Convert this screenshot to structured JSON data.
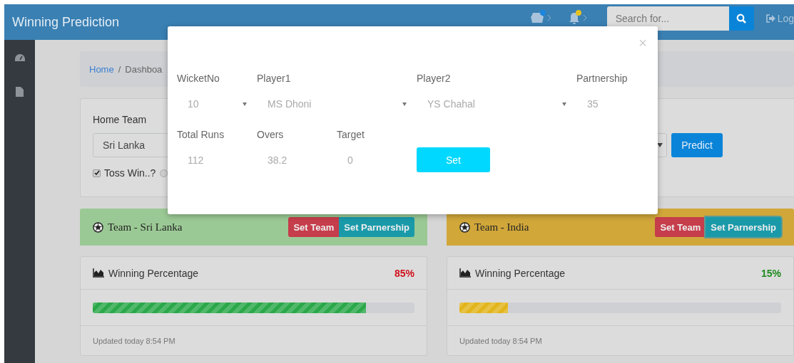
{
  "navbar": {
    "brand": "Winning Prediction",
    "notifications": [
      {
        "kind": "messages",
        "color": "#1a86e0"
      },
      {
        "kind": "alerts",
        "color": "#e6c21f"
      }
    ],
    "search": {
      "placeholder": "Search for..."
    },
    "logout": "Log"
  },
  "sidebar": {
    "items": [
      {
        "kind": "dashboard"
      },
      {
        "kind": "file"
      }
    ]
  },
  "breadcrumb": {
    "separator": "/",
    "items": [
      {
        "label": "Home",
        "kind": "link"
      },
      {
        "label": "Dashboa",
        "kind": "current"
      }
    ]
  },
  "prediction_form": {
    "home_team_label": "Home Team",
    "home_team": "Sri Lanka",
    "toss": {
      "label": "Toss Win..?",
      "checked": true
    },
    "toss_radio": {
      "selected": false
    },
    "predict_button": "Predict"
  },
  "teams": [
    {
      "title": "Team - Sri Lanka",
      "color": "#9bc995",
      "buttons": [
        {
          "label": "Set Team",
          "kind": "danger",
          "focused": false
        },
        {
          "label": "Set Parnership",
          "kind": "info",
          "focused": false
        }
      ],
      "winning": {
        "title": "Winning Percentage",
        "percent": {
          "text": "85%",
          "color": "#d0101b"
        },
        "bar": {
          "level": 0.85,
          "color": "#2ba84a"
        },
        "footer": "Updated today 8:54 PM"
      }
    },
    {
      "title": "Team - India",
      "color": "#d1a73a",
      "buttons": [
        {
          "label": "Set Team",
          "kind": "danger",
          "focused": false
        },
        {
          "label": "Set Parnership",
          "kind": "info",
          "focused": true
        }
      ],
      "winning": {
        "title": "Winning Percentage",
        "percent": {
          "text": "15%",
          "color": "#1e8a1e"
        },
        "bar": {
          "level": 0.15,
          "color": "#e2b51c"
        },
        "footer": "Updated today 8:54 PM"
      }
    }
  ],
  "modal": {
    "close": "×",
    "rows": [
      [
        {
          "label": "WicketNo",
          "value": "10",
          "kind": "select"
        },
        {
          "label": "Player1",
          "value": "MS Dhoni",
          "kind": "select"
        },
        {
          "label": "Player2",
          "value": "YS Chahal",
          "kind": "select"
        },
        {
          "label": "Partnership",
          "value": "35",
          "kind": "input"
        }
      ],
      [
        {
          "label": "Total Runs",
          "value": "112",
          "kind": "input"
        },
        {
          "label": "Overs",
          "value": "38.2",
          "kind": "input"
        },
        {
          "label": "Target",
          "value": "0",
          "kind": "input"
        }
      ]
    ],
    "set_button": "Set"
  }
}
